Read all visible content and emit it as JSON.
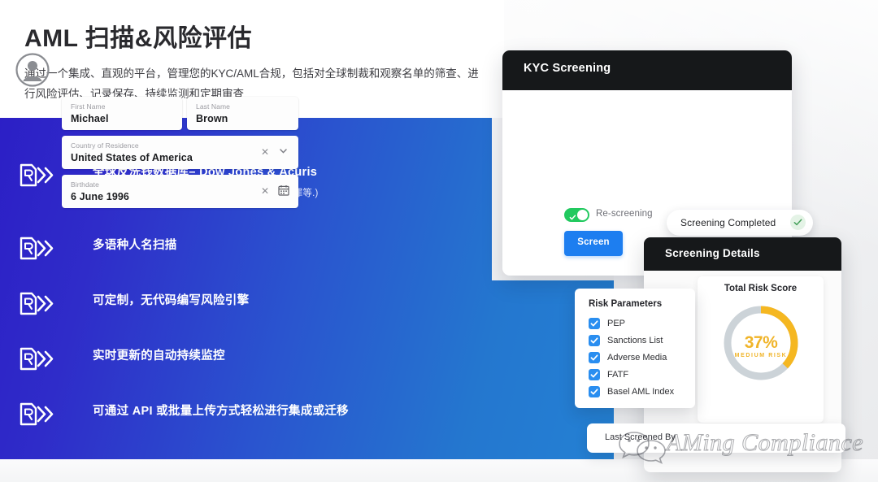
{
  "header": {
    "title": "AML 扫描&风险评估",
    "subtitle": "通过一个集成、直观的平台，管理您的KYC/AML合规，包括对全球制裁和观察名单的筛查、进行风险评估、记录保存、持续监测和定期审查"
  },
  "features": [
    {
      "title": "全球反洗钱数据库– Dow Jones & Acuris",
      "sub": "(制裁, 政治公众人物,负面新闻, 执法机构,金融犯罪等.)",
      "icon": "r-chevron-logo-icon"
    },
    {
      "title": "多语种人名扫描",
      "sub": "",
      "icon": "r-chevron-logo-icon"
    },
    {
      "title": "可定制，无代码编写风险引擎",
      "sub": "",
      "icon": "r-chevron-logo-icon"
    },
    {
      "title": "实时更新的自动持续监控",
      "sub": "",
      "icon": "r-chevron-logo-icon"
    },
    {
      "title": "可通过 API 或批量上传方式轻松进行集成或迁移",
      "sub": "",
      "icon": "r-chevron-logo-icon"
    }
  ],
  "kyc_card": {
    "title": "KYC Screening",
    "avatar_icon": "user-avatar-icon",
    "fields": [
      {
        "label": "First Name",
        "value": "Michael"
      },
      {
        "label": "Last Name",
        "value": "Brown"
      },
      {
        "label": "Country of Residence",
        "value": "United States of America",
        "clear_icon": "close-icon",
        "trailing_icon": "chevron-down-icon"
      },
      {
        "label": "Birthdate",
        "value": "6 June 1996",
        "clear_icon": "close-icon",
        "trailing_icon": "calendar-icon"
      }
    ],
    "toggle": {
      "label": "Re-screening",
      "state": "on",
      "icon": "check-icon"
    },
    "screen_button": "Screen"
  },
  "completed_pill": {
    "label": "Screening Completed",
    "icon": "check-circle-icon"
  },
  "details_card": {
    "title": "Screening Details",
    "score": {
      "title": "Total Risk Score",
      "value": "37%",
      "level": "MEDIUM RISK",
      "percent": 37,
      "arc_color": "#f5b721",
      "track_color": "#ccd3d8"
    }
  },
  "risk_card": {
    "title": "Risk Parameters",
    "items": [
      {
        "label": "PEP",
        "checked": true
      },
      {
        "label": "Sanctions List",
        "checked": true
      },
      {
        "label": "Adverse Media",
        "checked": true
      },
      {
        "label": "FATF",
        "checked": true
      },
      {
        "label": "Basel AML Index",
        "checked": true
      }
    ]
  },
  "last_screened": {
    "prefix": "Last",
    "text": "Last Screened By"
  },
  "watermark": {
    "text": "AMing Compliance",
    "logo_icon": "wechat-logo-icon"
  },
  "colors": {
    "panel_start": "#2c1fc6",
    "panel_end": "#2481d4",
    "accent_blue": "#1d7ef0",
    "toggle_green": "#21c95f",
    "risk_amber": "#f5b721",
    "dark_header": "#16181a"
  }
}
